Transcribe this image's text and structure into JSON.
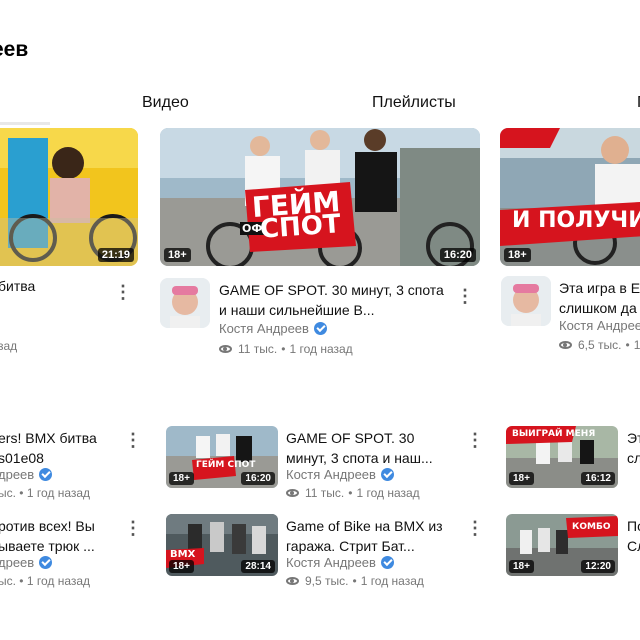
{
  "channel_title_fragment": "еев",
  "tabs": {
    "videos": "Видео",
    "playlists": "Плейлисты",
    "more": "П"
  },
  "top_cards": [
    {
      "title": "битва",
      "meta_tail": "зад",
      "duration": "21:19"
    },
    {
      "title": "GAME OF SPOT. 30 минут, 3 спота и наши сильнейшие В...",
      "channel": "Костя Андреев",
      "views": "11 тыс.",
      "time": "1 год назад",
      "age": "18+",
      "duration": "16:20",
      "promo_line1": "ГЕЙМ",
      "promo_small": "ОФ",
      "promo_line2": "СПОТ"
    },
    {
      "title": "Эта игра в Е слишком да",
      "channel": "Костя Андреев",
      "views": "6,5 тыс.",
      "time": "1 г",
      "age": "18+",
      "promo_line1": "И ПОЛУЧИ"
    }
  ],
  "list_rows": [
    {
      "left_title": "ers! BMX битва s01e08",
      "left_channel": "дреев",
      "left_meta": "ыс. • 1 год назад",
      "mid_title": "GAME OF SPOT. 30 минут, 3 спота и наш...",
      "mid_channel": "Костя Андреев",
      "mid_views": "11 тыс.",
      "mid_time": "1 год назад",
      "mid_age": "18+",
      "mid_duration": "16:20",
      "mid_promo": "ГЕЙМ СПОТ",
      "right_title": "Эт сл",
      "right_age": "18+",
      "right_duration": "16:12",
      "right_promo": "ВЫИГРАЙ МЕНЯ"
    },
    {
      "left_title": "ротив всех! Вы ываете трюк ...",
      "left_channel": "дреев",
      "left_meta": "ыс. • 1 год назад",
      "mid_title": "Game of Bike на BMX из гаража. Стрит Бат...",
      "mid_channel": "Костя Андреев",
      "mid_views": "9,5 тыс.",
      "mid_time": "1 год назад",
      "mid_age": "18+",
      "mid_duration": "28:14",
      "mid_promo": "BMX",
      "right_title": "По Сл",
      "right_age": "18+",
      "right_duration": "12:20",
      "right_promo": "КОМБО"
    }
  ],
  "separator": "•",
  "more_glyph": "⋮",
  "colors": {
    "promo_red": "#d6141e",
    "verified_blue": "#3f8ae0",
    "tab_text": "#111111",
    "meta_gray": "#777777"
  }
}
